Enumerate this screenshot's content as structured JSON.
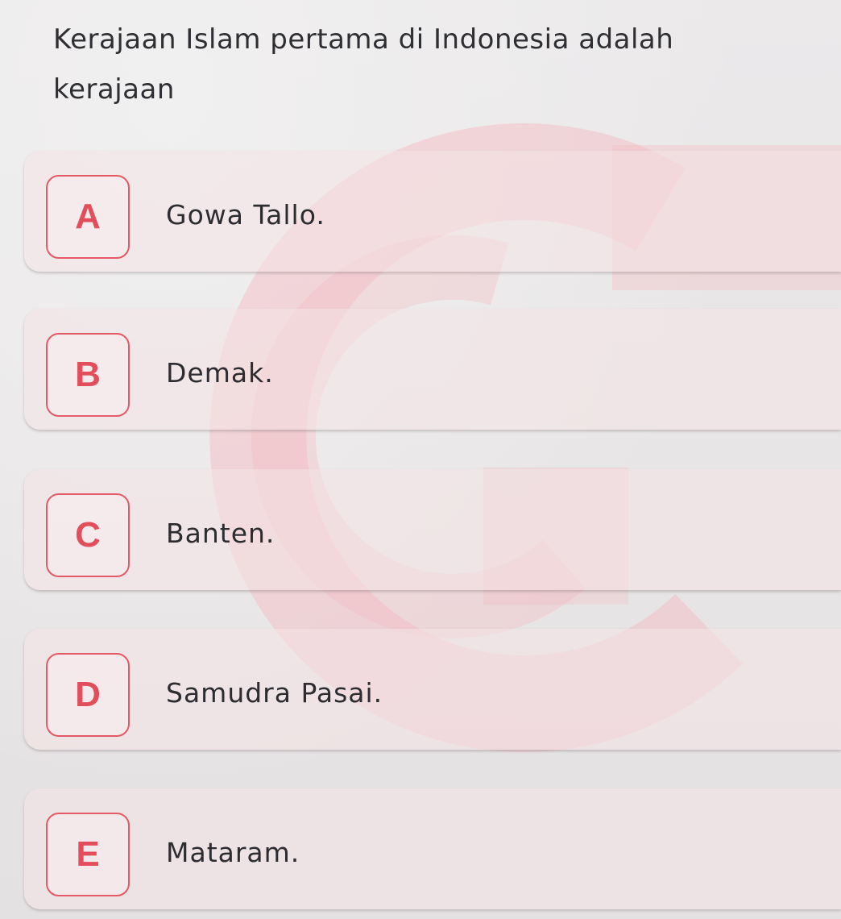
{
  "question": {
    "line1": "Kerajaan Islam pertama di Indonesia adalah",
    "line2": "kerajaan"
  },
  "options": [
    {
      "letter": "A",
      "text": "Gowa Tallo."
    },
    {
      "letter": "B",
      "text": "Demak."
    },
    {
      "letter": "C",
      "text": "Banten."
    },
    {
      "letter": "D",
      "text": "Samudra Pasai."
    },
    {
      "letter": "E",
      "text": "Mataram."
    }
  ],
  "colors": {
    "accent": "#e24e5c",
    "background": "#e6e3e4",
    "text": "#2c2c31",
    "watermark": "#f2c6cb"
  },
  "icons": {
    "watermark": "brand-watermark-icon"
  }
}
